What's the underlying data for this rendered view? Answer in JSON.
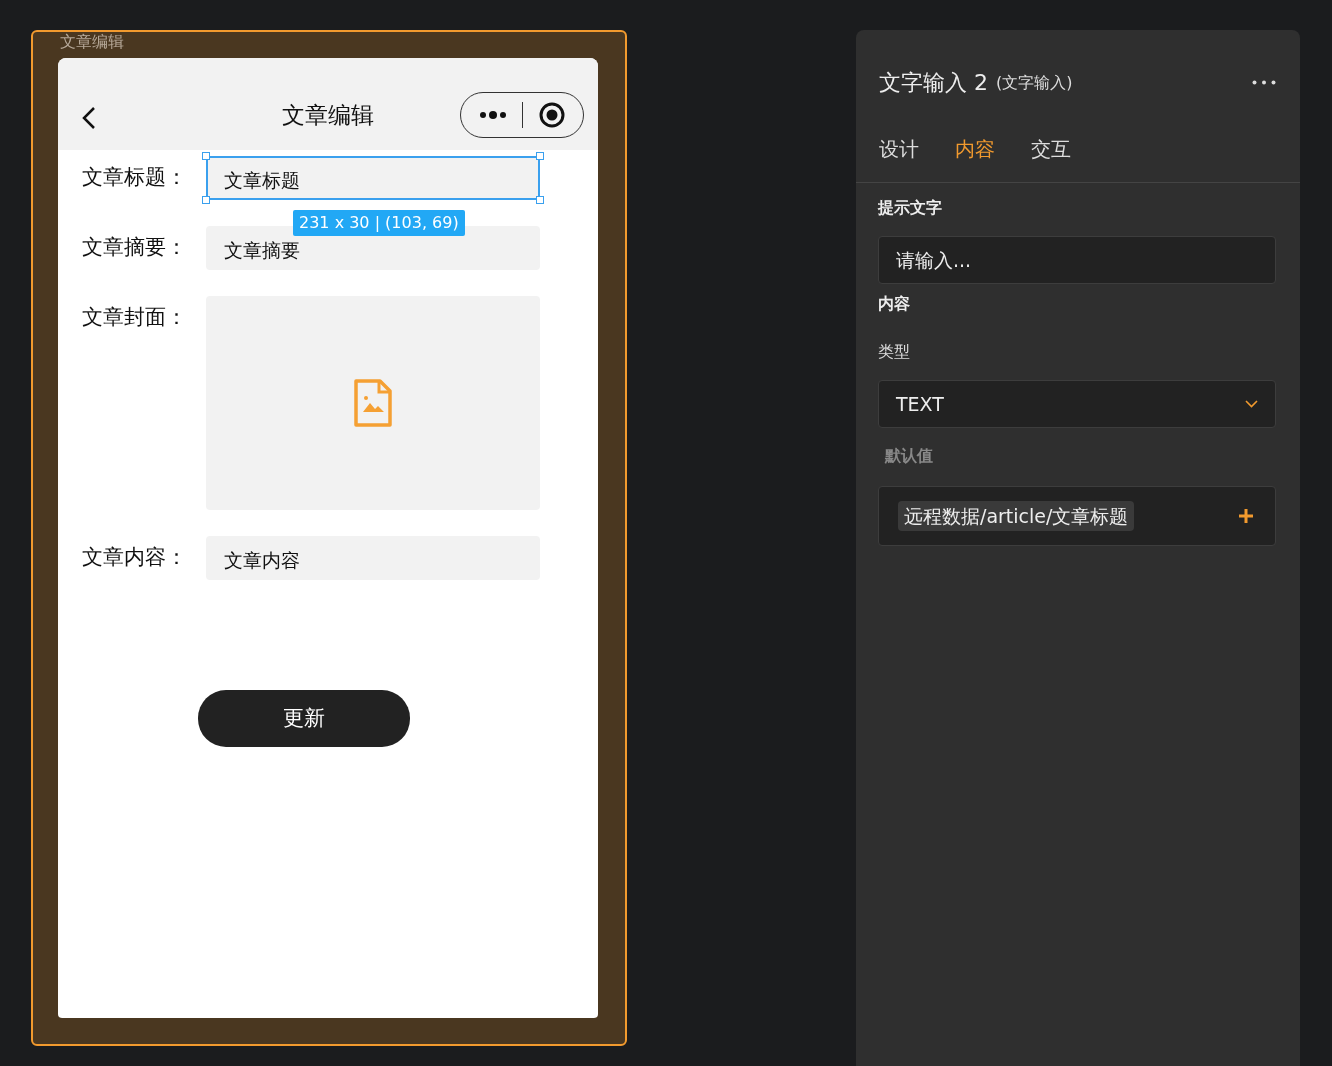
{
  "canvas": {
    "frame_label": "文章编辑",
    "page": {
      "nav_title": "文章编辑",
      "fields": [
        {
          "kind": "input",
          "label": "文章标题：",
          "value": "文章标题",
          "selected": true
        },
        {
          "kind": "input",
          "label": "文章摘要：",
          "value": "文章摘要",
          "selected": false
        },
        {
          "kind": "image",
          "label": "文章封面：",
          "selected": false
        },
        {
          "kind": "input",
          "label": "文章内容：",
          "value": "文章内容",
          "selected": false
        }
      ],
      "selection_tooltip": "231 x 30 | (103, 69)",
      "submit_button": "更新"
    }
  },
  "inspector": {
    "title": "文字输入 2",
    "subtitle": "(文字输入)",
    "tabs": [
      {
        "label": "设计",
        "selected": false
      },
      {
        "label": "内容",
        "selected": true
      },
      {
        "label": "交互",
        "selected": false
      }
    ],
    "hint_section": {
      "heading": "提示文字",
      "value": "请输入..."
    },
    "content_section": {
      "heading": "内容",
      "type_label": "类型",
      "type_value": "TEXT",
      "default_label": "默认值",
      "default_value": "远程数据/article/文章标题"
    }
  }
}
